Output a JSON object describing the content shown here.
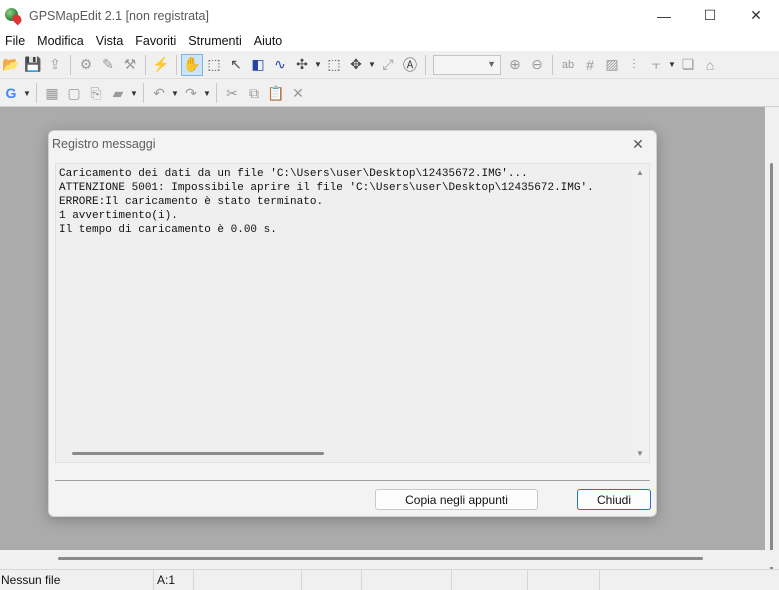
{
  "window": {
    "title": "GPSMapEdit 2.1 [non registrata]",
    "controls": {
      "minimize": "—",
      "maximize": "☐",
      "close": "✕"
    }
  },
  "menu": [
    "File",
    "Modifica",
    "Vista",
    "Favoriti",
    "Strumenti",
    "Aiuto"
  ],
  "dialog": {
    "title": "Registro messaggi",
    "close_glyph": "✕",
    "log_text": "Caricamento dei dati da un file 'C:\\Users\\user\\Desktop\\12435672.IMG'...\nATTENZIONE 5001: Impossibile aprire il file 'C:\\Users\\user\\Desktop\\12435672.IMG'.\nERRORE:Il caricamento è stato terminato.\n1 avvertimento(i).\nIl tempo di caricamento è 0.00 s.",
    "copy_button": "Copia negli appunti",
    "close_button": "Chiudi"
  },
  "statusbar": {
    "file": "Nessun file",
    "zoom": "A:1"
  }
}
